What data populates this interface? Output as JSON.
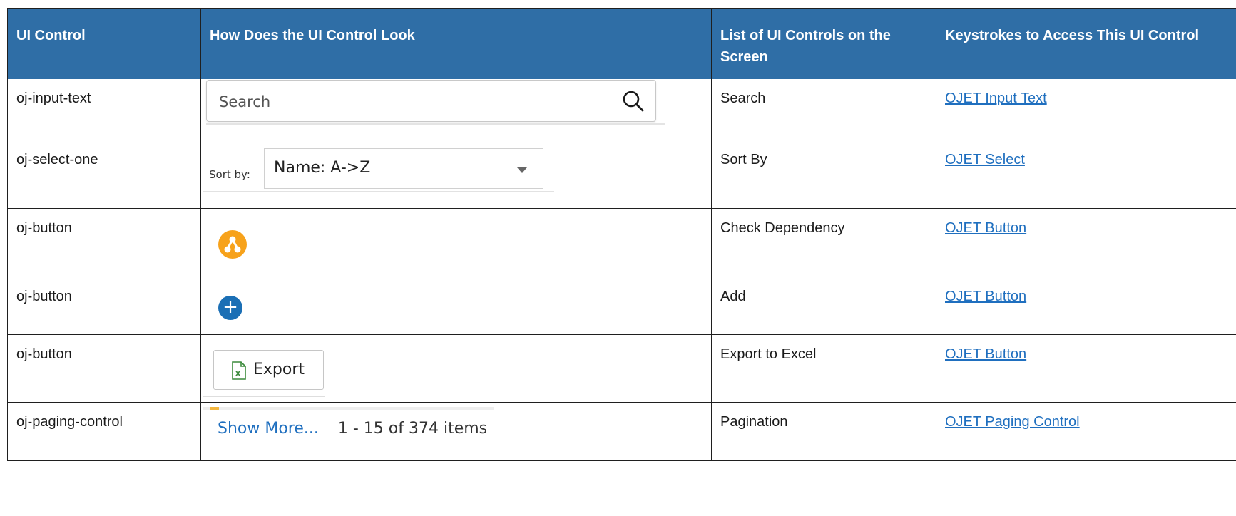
{
  "table": {
    "headers": [
      "UI Control",
      "How Does the UI Control Look",
      "List of UI Controls on the Screen",
      "Keystrokes to Access This UI Control"
    ],
    "rows": [
      {
        "control": "oj-input-text",
        "screen_control": "Search",
        "link": "OJET Input Text"
      },
      {
        "control": "oj-select-one",
        "screen_control": "Sort By",
        "link": "OJET Select"
      },
      {
        "control": "oj-button",
        "screen_control": "Check Dependency",
        "link": "OJET Button"
      },
      {
        "control": "oj-button",
        "screen_control": "Add",
        "link": "OJET Button"
      },
      {
        "control": "oj-button",
        "screen_control": "Export to Excel",
        "link": "OJET Button"
      },
      {
        "control": "oj-paging-control",
        "screen_control": "Pagination",
        "link": "OJET Paging Control"
      }
    ]
  },
  "demos": {
    "search_placeholder": "Search",
    "search_icon": "search-icon",
    "sort_label": "Sort by:",
    "sort_value": "Name: A->Z",
    "dependency_icon": "dependency-icon",
    "add_icon": "plus-icon",
    "add_glyph": "+",
    "export_label": "Export",
    "export_icon": "excel-icon",
    "paging_more": "Show More...",
    "paging_range": "1 - 15 of 374 items"
  },
  "colors": {
    "header_bg": "#2f6ea6",
    "link": "#1f6fbf",
    "dependency": "#f7a21b",
    "add": "#1b6fb5"
  }
}
